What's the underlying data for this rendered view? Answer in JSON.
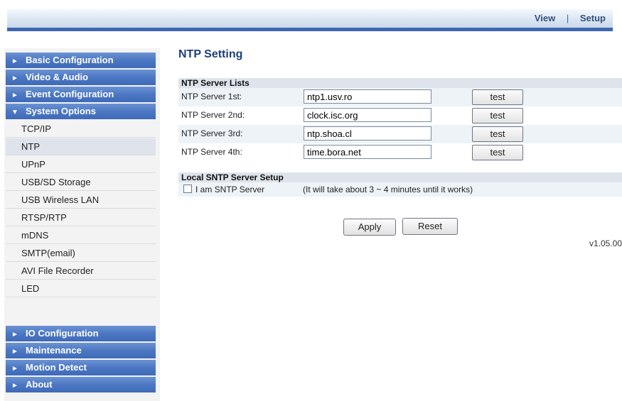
{
  "topnav": {
    "view": "View",
    "separator": "|",
    "setup": "Setup"
  },
  "sidebar": {
    "top_sections": [
      {
        "label": "Basic Configuration",
        "arrow": "►"
      },
      {
        "label": "Video & Audio",
        "arrow": "►"
      },
      {
        "label": "Event Configuration",
        "arrow": "►"
      },
      {
        "label": "System Options",
        "arrow": "▼"
      }
    ],
    "sub_items": [
      "TCP/IP",
      "NTP",
      "UPnP",
      "USB/SD Storage",
      "USB Wireless LAN",
      "RTSP/RTP",
      "mDNS",
      "SMTP(email)",
      "AVI File Recorder",
      "LED"
    ],
    "active_sub": "NTP",
    "bottom_sections": [
      {
        "label": "IO Configuration",
        "arrow": "►"
      },
      {
        "label": "Maintenance",
        "arrow": "►"
      },
      {
        "label": "Motion Detect",
        "arrow": "►"
      },
      {
        "label": "About",
        "arrow": "►"
      }
    ]
  },
  "main": {
    "title": "NTP Setting",
    "server_lists_header": "NTP Server Lists",
    "servers": [
      {
        "label": "NTP Server 1st:",
        "value": "ntp1.usv.ro",
        "button": "test"
      },
      {
        "label": "NTP Server 2nd:",
        "value": "clock.isc.org",
        "button": "test"
      },
      {
        "label": "NTP Server 3rd:",
        "value": "ntp.shoa.cl",
        "button": "test"
      },
      {
        "label": "NTP Server 4th:",
        "value": "time.bora.net",
        "button": "test"
      }
    ],
    "local_header": "Local SNTP Server Setup",
    "sntp_checkbox_label": "I am SNTP Server",
    "sntp_checked": false,
    "sntp_note": "(It will take about 3 ~ 4 minutes until it works)",
    "apply_label": "Apply",
    "reset_label": "Reset",
    "version": "v1.05.00"
  }
}
